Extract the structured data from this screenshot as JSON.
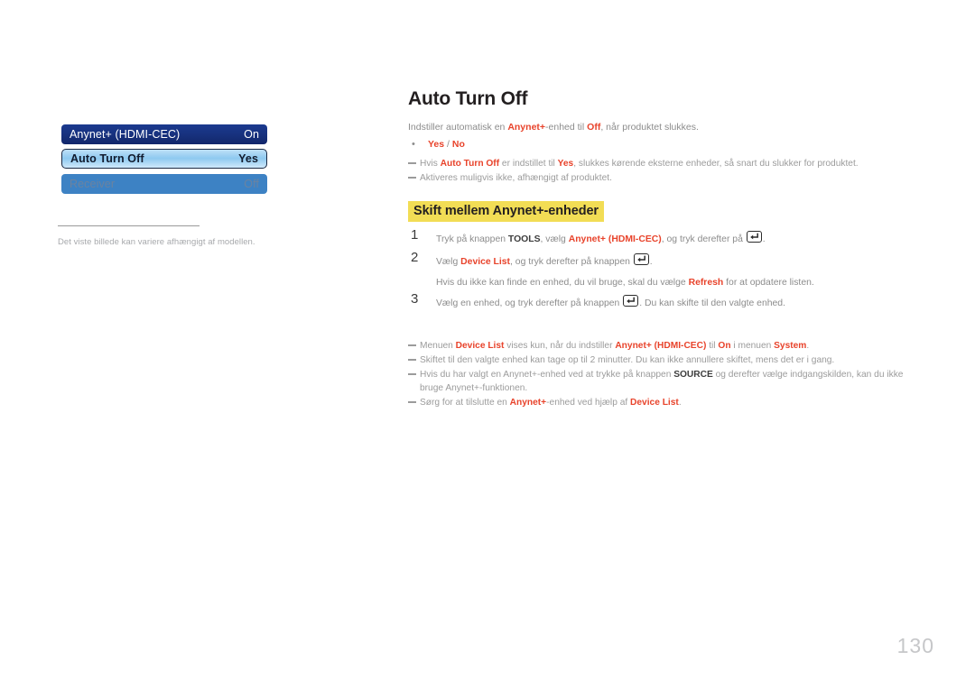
{
  "page": {
    "number": "130",
    "language": "da"
  },
  "left": {
    "osd_menu": {
      "rows": [
        {
          "label": "Anynet+ (HDMI-CEC)",
          "value": "On",
          "state": "header"
        },
        {
          "label": "Auto Turn Off",
          "value": "Yes",
          "state": "selected"
        },
        {
          "label": "Receiver",
          "value": "Off",
          "state": "disabled"
        }
      ]
    },
    "caption": "Det viste billede kan variere afhængigt af modellen."
  },
  "main": {
    "title": "Auto Turn Off",
    "description": {
      "parts": [
        {
          "t": "Indstiller automatisk en ",
          "s": "normal"
        },
        {
          "t": "Anynet+",
          "s": "orange"
        },
        {
          "t": "-enhed til ",
          "s": "normal"
        },
        {
          "t": "Off",
          "s": "orange"
        },
        {
          "t": ", når produktet slukkes.",
          "s": "normal"
        }
      ],
      "plain": "Indstiller automatisk en Anynet+-enhed til Off, når produktet slukkes."
    },
    "bullet": {
      "marker": "•",
      "option_yes": "Yes",
      "separator": " / ",
      "option_no": "No"
    },
    "notes_top": [
      {
        "plain": "Hvis Auto Turn Off er indstillet til Yes, slukkes kørende eksterne enheder, så snart du slukker for produktet.",
        "parts": [
          {
            "t": "Hvis ",
            "s": "normal"
          },
          {
            "t": "Auto Turn Off",
            "s": "orange"
          },
          {
            "t": " er indstillet til ",
            "s": "normal"
          },
          {
            "t": "Yes",
            "s": "orange"
          },
          {
            "t": ", slukkes kørende eksterne enheder, så snart du slukker for produktet.",
            "s": "normal"
          }
        ]
      },
      {
        "plain": "Aktiveres muligvis ikke, afhængigt af produktet.",
        "parts": [
          {
            "t": "Aktiveres muligvis ikke, afhængigt af produktet.",
            "s": "normal"
          }
        ]
      }
    ],
    "section_heading": "Skift mellem Anynet+-enheder",
    "steps": [
      {
        "number": "1",
        "plain": "Tryk på knappen TOOLS, vælg Anynet+ (HDMI-CEC), og tryk derefter på ↵.",
        "parts": [
          {
            "t": "Tryk på knappen ",
            "s": "normal"
          },
          {
            "t": "TOOLS",
            "s": "key"
          },
          {
            "t": ", vælg ",
            "s": "normal"
          },
          {
            "t": "Anynet+ (HDMI-CEC)",
            "s": "orange"
          },
          {
            "t": ", og tryk derefter på ",
            "s": "normal"
          },
          {
            "t": "enter-key-icon",
            "s": "icon"
          },
          {
            "t": ".",
            "s": "normal"
          }
        ]
      },
      {
        "number": "2",
        "plain": "Vælg Device List, og tryk derefter på knappen ↵.",
        "parts": [
          {
            "t": "Vælg ",
            "s": "normal"
          },
          {
            "t": "Device List",
            "s": "orange"
          },
          {
            "t": ", og tryk derefter på knappen ",
            "s": "normal"
          },
          {
            "t": "enter-key-icon",
            "s": "icon"
          },
          {
            "t": ".",
            "s": "normal"
          }
        ],
        "substep": {
          "plain": "Hvis du ikke kan finde en enhed, du vil bruge, skal du vælge Refresh for at opdatere listen.",
          "parts": [
            {
              "t": "Hvis du ikke kan finde en enhed, du vil bruge, skal du vælge ",
              "s": "normal"
            },
            {
              "t": "Refresh",
              "s": "orange"
            },
            {
              "t": " for at opdatere listen.",
              "s": "normal"
            }
          ]
        }
      },
      {
        "number": "3",
        "plain": "Vælg en enhed, og tryk derefter på knappen ↵. Du kan skifte til den valgte enhed.",
        "parts": [
          {
            "t": "Vælg en enhed, og tryk derefter på knappen ",
            "s": "normal"
          },
          {
            "t": "enter-key-icon",
            "s": "icon"
          },
          {
            "t": ". Du kan skifte til den valgte enhed.",
            "s": "normal"
          }
        ]
      }
    ],
    "notes_bottom": [
      {
        "plain": "Menuen Device List vises kun, når du indstiller Anynet+ (HDMI-CEC) til On i menuen System.",
        "parts": [
          {
            "t": "Menuen ",
            "s": "normal"
          },
          {
            "t": "Device List",
            "s": "orange"
          },
          {
            "t": " vises kun, når du indstiller ",
            "s": "normal"
          },
          {
            "t": "Anynet+ (HDMI-CEC)",
            "s": "orange"
          },
          {
            "t": " til ",
            "s": "normal"
          },
          {
            "t": "On",
            "s": "orange"
          },
          {
            "t": " i menuen ",
            "s": "normal"
          },
          {
            "t": "System",
            "s": "orange"
          },
          {
            "t": ".",
            "s": "normal"
          }
        ]
      },
      {
        "plain": "Skiftet til den valgte enhed kan tage op til 2 minutter. Du kan ikke annullere skiftet, mens det er i gang.",
        "parts": [
          {
            "t": "Skiftet til den valgte enhed kan tage op til 2 minutter. Du kan ikke annullere skiftet, mens det er i gang.",
            "s": "normal"
          }
        ]
      },
      {
        "plain": "Hvis du har valgt en Anynet+-enhed ved at trykke på knappen SOURCE og derefter vælge indgangskilden, kan du ikke bruge Anynet+-funktionen.",
        "parts": [
          {
            "t": "Hvis du har valgt en Anynet+-enhed ved at trykke på knappen ",
            "s": "normal"
          },
          {
            "t": "SOURCE",
            "s": "key"
          },
          {
            "t": " og derefter vælge indgangskilden, kan du ikke bruge Anynet+-funktionen.",
            "s": "normal"
          }
        ]
      },
      {
        "plain": "Sørg for at tilslutte en Anynet+-enhed ved hjælp af Device List.",
        "parts": [
          {
            "t": "Sørg for at tilslutte en ",
            "s": "normal"
          },
          {
            "t": "Anynet+",
            "s": "orange"
          },
          {
            "t": "-enhed ved hjælp af ",
            "s": "normal"
          },
          {
            "t": "Device List",
            "s": "orange"
          },
          {
            "t": ".",
            "s": "normal"
          }
        ]
      }
    ]
  },
  "colors": {
    "accent_orange": "#e8432b",
    "highlight_yellow": "#f2dd55",
    "osd_header_blue": "#17317d",
    "osd_selected_blue": "#8ec9f0",
    "osd_disabled_blue": "#3d82c4",
    "body_gray": "#8c8c8c",
    "title_black": "#231f20",
    "page_number_gray": "#c6c7c9"
  }
}
